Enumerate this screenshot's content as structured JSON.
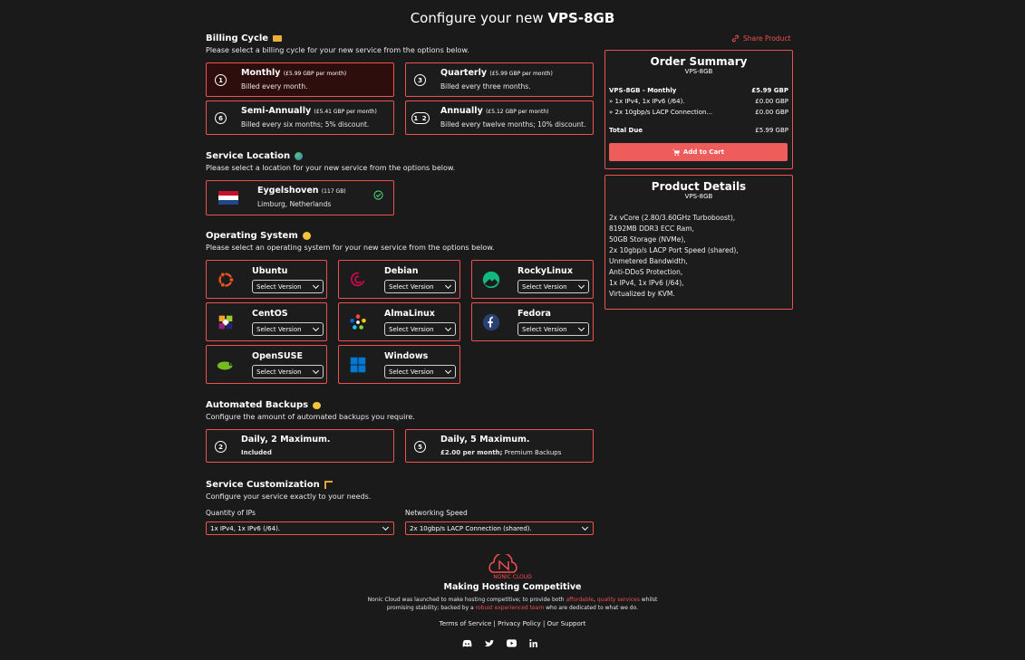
{
  "page_title": {
    "prefix": "Configure your new ",
    "product": "VPS-8GB"
  },
  "billing": {
    "heading": "Billing Cycle",
    "subtitle": "Please select a billing cycle for your new service from the options below.",
    "options": [
      {
        "num": "1",
        "name": "Monthly",
        "price": "(£5.99 GBP per month)",
        "desc": "Billed every month."
      },
      {
        "num": "3",
        "name": "Quarterly",
        "price": "(£5.99 GBP per month)",
        "desc": "Billed every three months."
      },
      {
        "num": "6",
        "name": "Semi-Annually",
        "price": "(£5.41 GBP per month)",
        "desc": "Billed every six months; 5% discount."
      },
      {
        "num": "1 2",
        "name": "Annually",
        "price": "(£5.12 GBP per month)",
        "desc": "Billed every twelve months; 10% discount."
      }
    ]
  },
  "share": {
    "label": "Share Product"
  },
  "location": {
    "heading": "Service Location",
    "subtitle": "Please select a location for your new service from the options below.",
    "name": "Eygelshoven",
    "capacity": "(117 GB)",
    "region": "Limburg, Netherlands"
  },
  "os": {
    "heading": "Operating System",
    "subtitle": "Please select an operating system for your new service from the options below.",
    "select_placeholder": "Select Version",
    "items": [
      {
        "name": "Ubuntu",
        "icon": "ubuntu-icon"
      },
      {
        "name": "Debian",
        "icon": "debian-icon"
      },
      {
        "name": "RockyLinux",
        "icon": "rockylinux-icon"
      },
      {
        "name": "CentOS",
        "icon": "centos-icon"
      },
      {
        "name": "AlmaLinux",
        "icon": "almalinux-icon"
      },
      {
        "name": "Fedora",
        "icon": "fedora-icon"
      },
      {
        "name": "OpenSUSE",
        "icon": "opensuse-icon"
      },
      {
        "name": "Windows",
        "icon": "windows-icon"
      }
    ]
  },
  "backups": {
    "heading": "Automated Backups",
    "subtitle": "Configure the amount of automated backups you require.",
    "options": [
      {
        "num": "2",
        "name": "Daily, 2 Maximum.",
        "desc": "Included"
      },
      {
        "num": "5",
        "name": "Daily, 5 Maximum.",
        "desc_bold": "£2.00 per month;",
        "desc": " Premium Backups"
      }
    ]
  },
  "custom": {
    "heading": "Service Customization",
    "subtitle": "Configure your service exactly to your needs.",
    "ips_label": "Quantity of IPs",
    "ips_value": "1x IPv4, 1x IPv6 (/64).",
    "net_label": "Networking Speed",
    "net_value": "2x 10gbp/s LACP Connection (shared)."
  },
  "summary": {
    "title": "Order Summary",
    "sub": "VPS-8GB",
    "rows": [
      {
        "label": "VPS-8GB - Monthly",
        "value": "£5.99 GBP"
      },
      {
        "label": "» 1x IPv4, 1x IPv6 (/64).",
        "value": "£0.00 GBP"
      },
      {
        "label": "» 2x 10gbp/s LACP Connection...",
        "value": "£0.00 GBP"
      }
    ],
    "total_label": "Total Due",
    "total_value": "£5.99 GBP",
    "cart_label": "Add to Cart"
  },
  "details": {
    "title": "Product Details",
    "sub": "VPS-8GB",
    "lines": [
      "2x vCore (2.80/3.60GHz Turboboost),",
      "8192MB DDR3 ECC Ram,",
      "50GB Storage (NVMe),",
      "2x 10gbp/s LACP Port Speed (shared),",
      "Unmetered Bandwidth,",
      "Anti-DDoS Protection,",
      "1x IPv4, 1x IPv6 (/64),",
      "Virtualized by KVM."
    ]
  },
  "footer": {
    "logo_text": "NONIC CLOUD",
    "tagline": "Making Hosting Competitive",
    "p1": "Nonic Cloud was launched to make hosting competitive; to provide both ",
    "w1": "affordable",
    "p2": ", ",
    "w2": "quality services",
    "p3": " whilst",
    "p4": "promising stability; backed by a ",
    "w3": "robust experienced team",
    "p5": " who are dedicated to what we do.",
    "links": [
      "Terms of Service",
      "Privacy Policy",
      "Our Support"
    ]
  },
  "colors": {
    "accent": "#f0504f",
    "background": "#1a1a1a"
  }
}
